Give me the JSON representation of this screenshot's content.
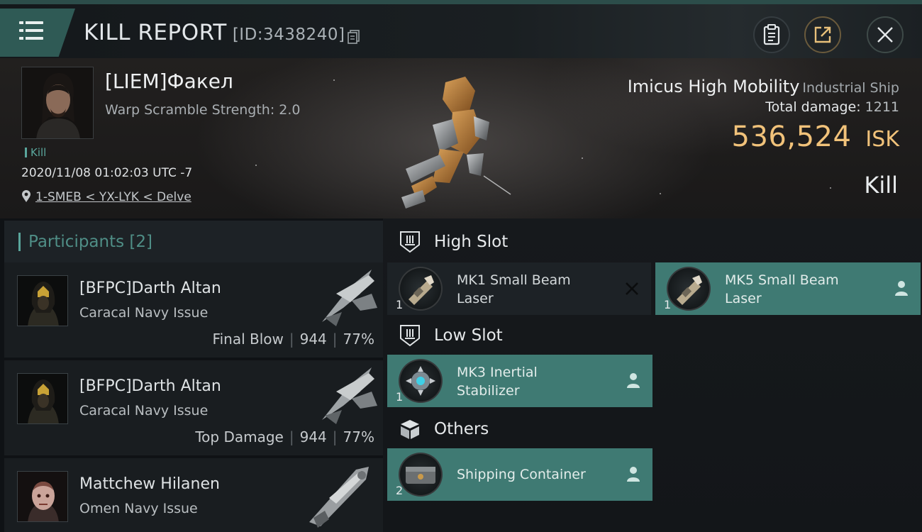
{
  "header": {
    "title": "KILL REPORT",
    "report_id": "[ID:3438240]"
  },
  "victim": {
    "name": "[LIEM]Факел",
    "warp_scramble": "Warp Scramble Strength: 2.0",
    "tag": "Kill",
    "datetime": "2020/11/08 01:02:03 UTC -7",
    "location": "1-SMEB < YX-LYK < Delve",
    "ship_name": "Imicus High Mobility",
    "ship_class": "Industrial Ship",
    "total_damage_label": "Total damage:",
    "total_damage": "1211",
    "isk_value": "536,524",
    "isk_unit": "ISK",
    "result": "Kill"
  },
  "participants": {
    "label": "Participants",
    "count": "[2]",
    "rows": [
      {
        "name": "[BFPC]Darth Altan",
        "ship": "Caracal Navy Issue",
        "role": "Final Blow",
        "damage": "944",
        "percent": "77%"
      },
      {
        "name": "[BFPC]Darth Altan",
        "ship": "Caracal Navy Issue",
        "role": "Top Damage",
        "damage": "944",
        "percent": "77%"
      },
      {
        "name": "Mattchew Hilanen",
        "ship": "Omen Navy Issue"
      }
    ]
  },
  "fitting": {
    "high_slot": {
      "label": "High Slot",
      "modules": [
        {
          "line1": "MK1 Small Beam",
          "line2": "Laser",
          "qty": "1",
          "status": "destroyed"
        },
        {
          "line1": "MK5 Small Beam",
          "line2": "Laser",
          "qty": "1",
          "status": "dropped"
        }
      ]
    },
    "low_slot": {
      "label": "Low Slot",
      "modules": [
        {
          "line1": "MK3 Inertial",
          "line2": "Stabilizer",
          "qty": "1",
          "status": "dropped"
        }
      ]
    },
    "others": {
      "label": "Others",
      "modules": [
        {
          "line1": "Shipping Container",
          "qty": "2",
          "status": "dropped"
        }
      ]
    }
  },
  "colors": {
    "accent_teal": "#3f7a73",
    "isk_gold": "#f1c27a",
    "label_teal": "#5aa69c"
  }
}
